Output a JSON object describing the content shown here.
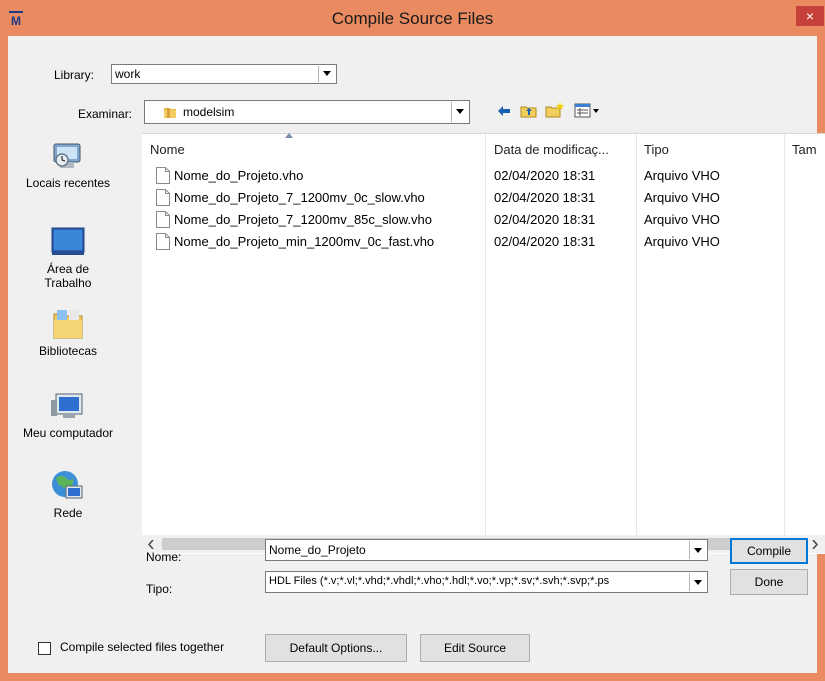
{
  "window": {
    "title": "Compile Source Files",
    "close_glyph": "×"
  },
  "library": {
    "label": "Library:",
    "value": "work"
  },
  "examinar": {
    "label": "Examinar:",
    "value": "modelsim"
  },
  "nav": [
    {
      "label": "Locais recentes",
      "icon": "recent-places-icon"
    },
    {
      "label": "Área de\nTrabalho",
      "icon": "desktop-icon"
    },
    {
      "label": "Bibliotecas",
      "icon": "libraries-icon"
    },
    {
      "label": "Meu computador",
      "icon": "computer-icon"
    },
    {
      "label": "Rede",
      "icon": "network-icon"
    }
  ],
  "columns": {
    "name": "Nome",
    "date": "Data de modificaç...",
    "type": "Tipo",
    "size": "Tam"
  },
  "files": [
    {
      "name": "Nome_do_Projeto.vho",
      "date": "02/04/2020 18:31",
      "type": "Arquivo VHO"
    },
    {
      "name": "Nome_do_Projeto_7_1200mv_0c_slow.vho",
      "date": "02/04/2020 18:31",
      "type": "Arquivo VHO"
    },
    {
      "name": "Nome_do_Projeto_7_1200mv_85c_slow.vho",
      "date": "02/04/2020 18:31",
      "type": "Arquivo VHO"
    },
    {
      "name": "Nome_do_Projeto_min_1200mv_0c_fast.vho",
      "date": "02/04/2020 18:31",
      "type": "Arquivo VHO"
    }
  ],
  "filename": {
    "label": "Nome:",
    "value": "Nome_do_Projeto"
  },
  "filetype": {
    "label": "Tipo:",
    "value": "HDL Files (*.v;*.vl;*.vhd;*.vhdl;*.vho;*.hdl;*.vo;*.vp;*.sv;*.svh;*.svp;*.ps"
  },
  "buttons": {
    "compile": "Compile",
    "done": "Done",
    "default_options": "Default Options...",
    "edit_source": "Edit Source"
  },
  "compile_together": {
    "label": "Compile selected files together",
    "checked": false
  },
  "colors": {
    "title_bar": "#e98a60",
    "close": "#c7403a",
    "client": "#f0f0f0"
  }
}
